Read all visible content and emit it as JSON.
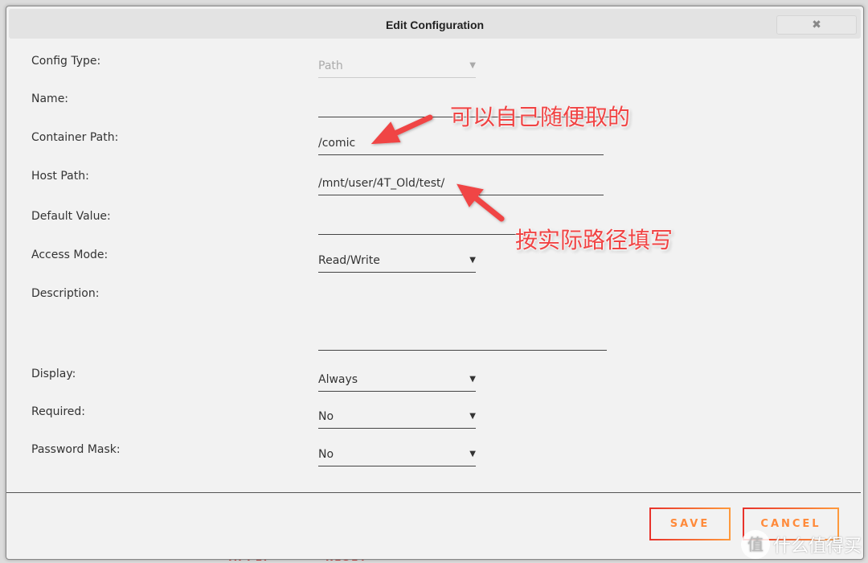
{
  "background": {
    "apply_label": "APPLY",
    "reset_label": "RESET"
  },
  "dialog": {
    "title": "Edit Configuration",
    "close_label": "✖"
  },
  "fields": [
    {
      "label": "Config Type:",
      "value": "Path",
      "type": "select",
      "disabled": true
    },
    {
      "label": "Name:",
      "value": "",
      "type": "text"
    },
    {
      "label": "Container Path:",
      "value": "/comic",
      "type": "text"
    },
    {
      "label": "Host Path:",
      "value": "/mnt/user/4T_Old/test/",
      "type": "text"
    },
    {
      "label": "Default Value:",
      "value": "",
      "type": "text"
    },
    {
      "label": "Access Mode:",
      "value": "Read/Write",
      "type": "select"
    },
    {
      "label": "Description:",
      "value": "",
      "type": "textarea"
    },
    {
      "label": "Display:",
      "value": "Always",
      "type": "select"
    },
    {
      "label": "Required:",
      "value": "No",
      "type": "select"
    },
    {
      "label": "Password Mask:",
      "value": "No",
      "type": "select"
    }
  ],
  "buttons": {
    "save": "SAVE",
    "cancel": "CANCEL"
  },
  "annotations": {
    "name_note": "可以自己随便取的",
    "path_note": "按实际路径填写",
    "color": "#f04444"
  },
  "watermark": {
    "logo": "值",
    "text": "什么值得买"
  }
}
